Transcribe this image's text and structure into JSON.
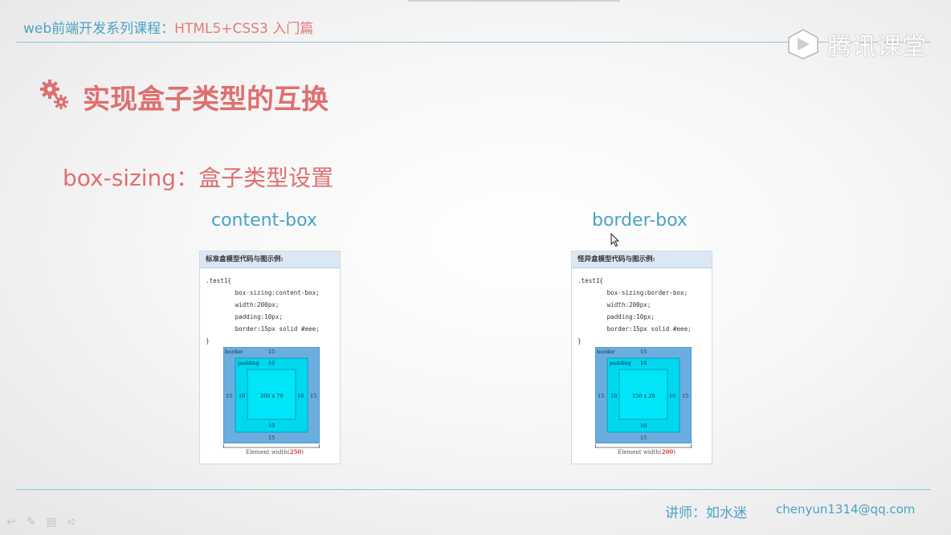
{
  "header": {
    "title_part1": "web前端开发系列课程：",
    "title_part2": "HTML5+CSS3  入门篇"
  },
  "logo": {
    "text": "腾讯课堂",
    "icon": "tencent-classroom-logo-icon"
  },
  "slide": {
    "title": "实现盒子类型的互换",
    "subtitle": "box-sizing：盒子类型设置"
  },
  "examples": [
    {
      "label": "content-box",
      "panel_title": "标准盒模型代码与图示例:",
      "code": [
        ".test1{",
        "        box-sizing:content-box;",
        "        width:200px;",
        "        padding:10px;",
        "        border:15px solid #eee;",
        "}"
      ],
      "diagram": {
        "border_label": "border",
        "border_value": "15",
        "padding_label": "padding",
        "padding_value": "10",
        "content": "200 x 70"
      },
      "element_width_label": "Element width(",
      "element_width_value": "250",
      "element_width_close": ")"
    },
    {
      "label": "border-box",
      "panel_title": "怪异盒模型代码与图示例:",
      "code": [
        ".test1{",
        "        box-sizing:border-box;",
        "        width:200px;",
        "        padding:10px;",
        "        border:15px solid #eee;",
        "}"
      ],
      "diagram": {
        "border_label": "border",
        "border_value": "15",
        "padding_label": "padding",
        "padding_value": "10",
        "content": "150 x 20"
      },
      "element_width_label": "Element width(",
      "element_width_value": "200",
      "element_width_close": ")"
    }
  ],
  "footer": {
    "teacher": "讲师：如水迷",
    "email": "chenyun1314@qq.com"
  },
  "toolbar": {
    "icons": [
      "undo-arrow-icon",
      "pen-icon",
      "slides-icon",
      "next-arrow-icon"
    ]
  },
  "colors": {
    "accent_blue": "#4aa3c6",
    "accent_red": "#e06f6f",
    "border_box": "#6aaee0",
    "padding_box": "#00d8f0",
    "content_box": "#00e5f7"
  }
}
